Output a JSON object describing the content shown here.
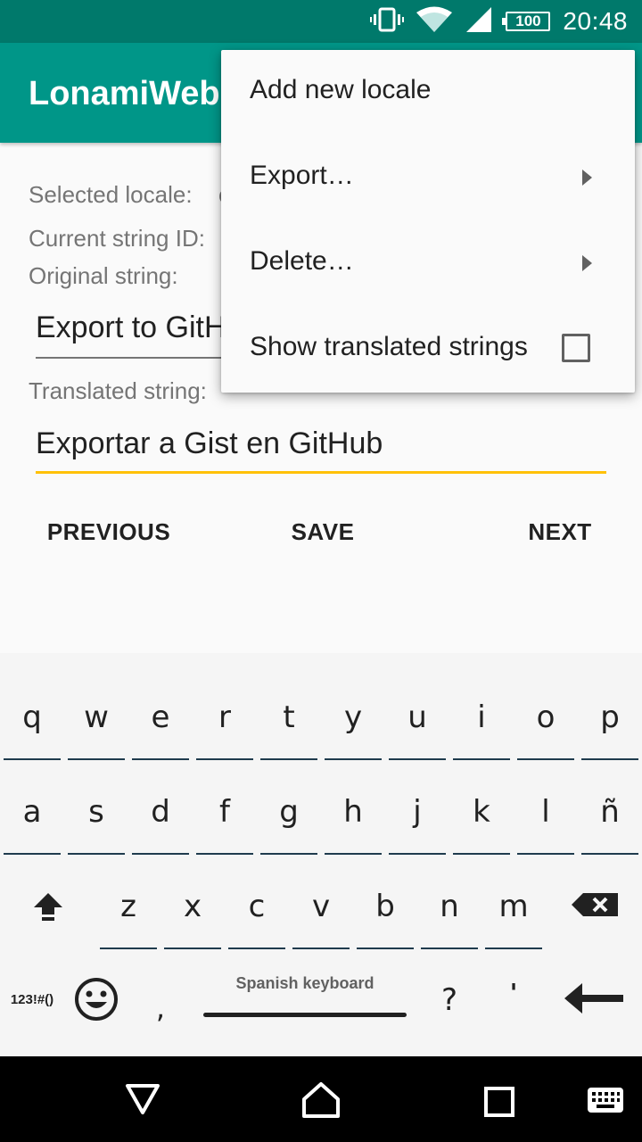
{
  "status_bar": {
    "battery": "100",
    "time": "20:48",
    "icons": [
      "vibrate-icon",
      "wifi-icon",
      "signal-icon",
      "battery-icon"
    ]
  },
  "app_bar": {
    "title": "LonamiWebs"
  },
  "content": {
    "selected_locale_label": "Selected locale:",
    "selected_locale_value": "e",
    "current_string_id_label": "Current string ID:",
    "original_string_label": "Original string:",
    "original_string_value": "Export to GitHub Gist",
    "translated_string_label": "Translated string:",
    "translated_string_value": "Exportar a Gist en GitHub"
  },
  "buttons": {
    "previous": "PREVIOUS",
    "save": "SAVE",
    "next": "NEXT"
  },
  "menu": {
    "items": [
      {
        "label": "Add new locale",
        "submenu": false
      },
      {
        "label": "Export…",
        "submenu": true
      },
      {
        "label": "Delete…",
        "submenu": true
      },
      {
        "label": "Show translated strings",
        "checkbox": false
      }
    ]
  },
  "keyboard": {
    "row1": [
      "q",
      "w",
      "e",
      "r",
      "t",
      "y",
      "u",
      "i",
      "o",
      "p"
    ],
    "row2": [
      "a",
      "s",
      "d",
      "f",
      "g",
      "h",
      "j",
      "k",
      "l",
      "ñ"
    ],
    "row3": [
      "z",
      "x",
      "c",
      "v",
      "b",
      "n",
      "m"
    ],
    "symbols_key": "123!#()",
    "comma": ",",
    "space_label": "Spanish keyboard",
    "question": "?",
    "apostrophe": "'"
  },
  "colors": {
    "primary": "#009688",
    "primary_dark": "#00796b",
    "accent": "#ffc107"
  }
}
